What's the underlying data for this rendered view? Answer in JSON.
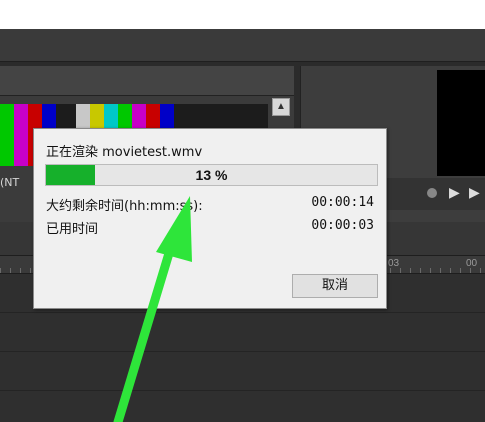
{
  "dialog": {
    "title": "正在渲染 movietest.wmv",
    "progress_percent": 13,
    "progress_label": "13 %",
    "remaining_label": "大约剩余时间(hh:mm:ss):",
    "remaining_value": "00:00:14",
    "elapsed_label": "已用时间",
    "elapsed_value": "00:00:03",
    "cancel_label": "取消"
  },
  "background": {
    "ntsc_label": "(NT",
    "ruler_label_1": "03",
    "ruler_label_2": "00"
  },
  "colors": {
    "progress_fill": "#16b02b",
    "arrow": "#2ee53a",
    "colorbar_top": [
      "#c8c8c8",
      "#c8c800",
      "#00c8c8",
      "#00c800",
      "#c800c8",
      "#c80000",
      "#0000c8"
    ]
  }
}
